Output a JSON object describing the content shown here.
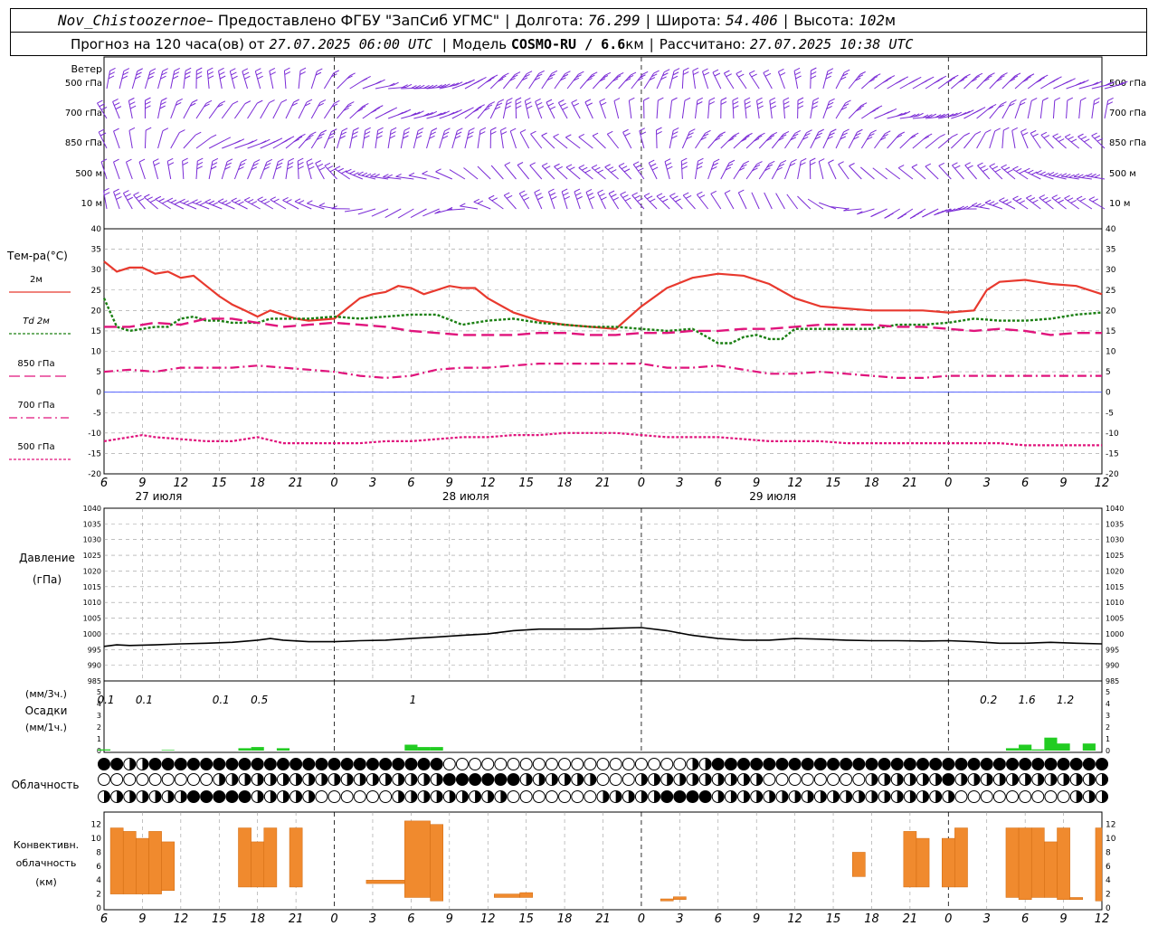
{
  "header": {
    "station": "Nov_Chistoozernoe",
    "provider": " – Предоставлено ФГБУ \"ЗапСиб УГМС\"",
    "lon_label": "Долгота:",
    "lon": "76.299",
    "lat_label": "Широта:",
    "lat": "54.406",
    "alt_label": "Высота:",
    "alt": "102",
    "alt_unit": "м",
    "forecast_label": "Прогноз на 120 часа(ов) от",
    "forecast_start": "27.07.2025 06:00 UTC",
    "model_label": "Модель",
    "model": "COSMO-RU / 6.6",
    "model_unit": "км",
    "calc_label": "Рассчитано:",
    "calc_time": "27.07.2025 10:38 UTC"
  },
  "wind_panel": {
    "title": "Ветер",
    "levels": [
      "500 гПа",
      "700 гПа",
      "850 гПа",
      "500  м",
      "10   м"
    ]
  },
  "temp_panel": {
    "title": "Тем-ра(°С)",
    "legend": [
      {
        "label": "2м",
        "color": "#e8392e",
        "style": "solid"
      },
      {
        "label": "Td  2м",
        "color": "#1a7f12",
        "style": "dotted"
      },
      {
        "label": "850 гПа",
        "color": "#e0147c",
        "style": "dashed"
      },
      {
        "label": "700 гПа",
        "color": "#e0147c",
        "style": "dashdot"
      },
      {
        "label": "500 гПа",
        "color": "#e0147c",
        "style": "dotted"
      }
    ]
  },
  "pressure_panel": {
    "title_line1": "Давление",
    "title_line2": "(гПа)"
  },
  "precip_panel": {
    "unit3": "(мм/3ч.)",
    "title": "Осадки",
    "unit1": "(мм/1ч.)",
    "labels": [
      {
        "x": 6,
        "text": "0.1"
      },
      {
        "x": 9,
        "text": "0.1"
      },
      {
        "x": 15,
        "text": "0.1"
      },
      {
        "x": 18,
        "text": "0.5"
      },
      {
        "x": 30,
        "text": "1"
      },
      {
        "x": 75,
        "text": "0.2"
      },
      {
        "x": 78,
        "text": "1.6"
      },
      {
        "x": 81,
        "text": "1.2"
      }
    ]
  },
  "cloud_panel": {
    "title": "Облачность"
  },
  "conv_panel": {
    "title_line1": "Конвективн.",
    "title_line2": "облачность",
    "title_line3": "(км)"
  },
  "chart_data": [
    {
      "type": "wind_barbs",
      "x_hours_range": [
        6,
        84
      ],
      "levels": [
        "500 гПа",
        "700 гПа",
        "850 гПа",
        "500  м",
        "10   м"
      ]
    },
    {
      "type": "line",
      "x_hours_range": [
        6,
        84
      ],
      "ylim": [
        -20,
        40
      ],
      "yticks": [
        -20,
        -15,
        -10,
        -5,
        0,
        5,
        10,
        15,
        20,
        25,
        30,
        35,
        40
      ],
      "grid": true,
      "series": [
        {
          "name": "2м",
          "x": [
            6,
            7,
            8,
            9,
            10,
            11,
            12,
            13,
            14,
            15,
            16,
            17,
            18,
            19,
            20,
            21,
            22,
            24,
            26,
            27,
            28,
            29,
            30,
            31,
            32,
            33,
            34,
            35,
            36,
            38,
            40,
            42,
            44,
            46,
            48,
            50,
            52,
            54,
            56,
            58,
            60,
            62,
            64,
            66,
            68,
            70,
            72,
            74,
            75,
            76,
            78,
            80,
            82,
            84
          ],
          "values": [
            32,
            29.5,
            30.5,
            30.5,
            29,
            29.5,
            28,
            28.5,
            26,
            23.5,
            21.5,
            20,
            18.5,
            20,
            19,
            18,
            17.5,
            18,
            23,
            24,
            24.5,
            26,
            25.5,
            24,
            25,
            26,
            25.5,
            25.5,
            23,
            19.5,
            17.5,
            16.5,
            16,
            15.5,
            21,
            25.5,
            28,
            29,
            28.5,
            26.5,
            23,
            21,
            20.5,
            20,
            20,
            20,
            19.5,
            20,
            25,
            27,
            27.5,
            26.5,
            26,
            24
          ]
        },
        {
          "name": "Td  2м",
          "x": [
            6,
            7,
            8,
            9,
            10,
            11,
            12,
            13,
            14,
            15,
            16,
            17,
            18,
            19,
            20,
            21,
            22,
            24,
            26,
            28,
            30,
            32,
            34,
            36,
            38,
            40,
            42,
            44,
            46,
            48,
            50,
            52,
            54,
            55,
            56,
            57,
            58,
            59,
            60,
            62,
            64,
            66,
            68,
            70,
            72,
            74,
            76,
            78,
            80,
            82,
            84
          ],
          "values": [
            23,
            16,
            15,
            15.5,
            16,
            16,
            18,
            18.5,
            17.5,
            17.5,
            17,
            17,
            17,
            18,
            18,
            18,
            18,
            18.5,
            18,
            18.5,
            19,
            19,
            16.5,
            17.5,
            18,
            17,
            16.5,
            16,
            16,
            15.5,
            15,
            15.5,
            12,
            12,
            13.5,
            14,
            13,
            13,
            15.5,
            15.5,
            15.5,
            15.5,
            16.5,
            16.5,
            17,
            18,
            17.5,
            17.5,
            18,
            19,
            19.5
          ]
        },
        {
          "name": "850 гПа",
          "x": [
            6,
            8,
            10,
            12,
            14,
            16,
            18,
            20,
            22,
            24,
            26,
            28,
            30,
            32,
            34,
            36,
            38,
            40,
            42,
            44,
            46,
            48,
            50,
            52,
            54,
            56,
            58,
            60,
            62,
            64,
            66,
            68,
            70,
            72,
            74,
            76,
            78,
            80,
            82,
            84
          ],
          "values": [
            16,
            16,
            17,
            16.5,
            18,
            18,
            17,
            16,
            16.5,
            17,
            16.5,
            16,
            15,
            14.5,
            14,
            14,
            14,
            14.5,
            14.5,
            14,
            14,
            14.5,
            14.5,
            15,
            15,
            15.5,
            15.5,
            16,
            16.5,
            16.5,
            16.5,
            16,
            16,
            15.5,
            15,
            15.5,
            15,
            14,
            14.5,
            14.5
          ]
        },
        {
          "name": "700 гПа",
          "x": [
            6,
            8,
            10,
            12,
            14,
            16,
            18,
            20,
            22,
            24,
            26,
            28,
            30,
            32,
            34,
            36,
            38,
            40,
            42,
            44,
            46,
            48,
            50,
            52,
            54,
            56,
            58,
            60,
            62,
            64,
            66,
            68,
            70,
            72,
            74,
            76,
            78,
            80,
            82,
            84
          ],
          "values": [
            5,
            5.5,
            5,
            6,
            6,
            6,
            6.5,
            6,
            5.5,
            5,
            4,
            3.5,
            4,
            5.5,
            6,
            6,
            6.5,
            7,
            7,
            7,
            7,
            7,
            6,
            6,
            6.5,
            5.5,
            4.5,
            4.5,
            5,
            4.5,
            4,
            3.5,
            3.5,
            4,
            4,
            4,
            4,
            4,
            4,
            4
          ]
        },
        {
          "name": "500 гПа",
          "x": [
            6,
            8,
            9,
            10,
            12,
            14,
            16,
            18,
            20,
            22,
            24,
            26,
            28,
            30,
            32,
            34,
            36,
            38,
            40,
            42,
            44,
            46,
            48,
            50,
            52,
            54,
            56,
            58,
            60,
            62,
            64,
            66,
            68,
            70,
            72,
            74,
            76,
            78,
            80,
            82,
            84
          ],
          "values": [
            -12,
            -11,
            -10.5,
            -11,
            -11.5,
            -12,
            -12,
            -11,
            -12.5,
            -12.5,
            -12.5,
            -12.5,
            -12,
            -12,
            -11.5,
            -11,
            -11,
            -10.5,
            -10.5,
            -10,
            -10,
            -10,
            -10.5,
            -11,
            -11,
            -11,
            -11.5,
            -12,
            -12,
            -12,
            -12.5,
            -12.5,
            -12.5,
            -12.5,
            -12.5,
            -12.5,
            -12.5,
            -13,
            -13,
            -13,
            -13
          ]
        }
      ]
    },
    {
      "type": "line",
      "x_hours_range": [
        6,
        84
      ],
      "ylim": [
        985,
        1040
      ],
      "yticks": [
        985,
        990,
        995,
        1000,
        1005,
        1010,
        1015,
        1020,
        1025,
        1030,
        1035,
        1040
      ],
      "grid": true,
      "series": [
        {
          "name": "",
          "x": [
            6,
            7,
            8,
            10,
            12,
            14,
            16,
            18,
            19,
            20,
            22,
            24,
            26,
            28,
            30,
            32,
            34,
            36,
            38,
            40,
            42,
            44,
            46,
            48,
            50,
            52,
            54,
            56,
            58,
            60,
            62,
            64,
            66,
            68,
            70,
            72,
            74,
            76,
            78,
            80,
            82,
            84
          ],
          "values": [
            996,
            996.5,
            996.3,
            996.5,
            996.8,
            997,
            997.3,
            998,
            998.5,
            998,
            997.5,
            997.5,
            997.8,
            998,
            998.5,
            999,
            999.5,
            1000,
            1001,
            1001.5,
            1001.5,
            1001.5,
            1001.8,
            1002,
            1001,
            999.5,
            998.5,
            998,
            998,
            998.5,
            998.3,
            998,
            997.8,
            997.8,
            997.7,
            997.8,
            997.5,
            997,
            997,
            997.3,
            997,
            996.8
          ]
        }
      ]
    },
    {
      "type": "bar",
      "x_hours_range": [
        6,
        84
      ],
      "ylim": [
        0,
        5
      ],
      "yticks": [
        0,
        1,
        2,
        3,
        4,
        5
      ],
      "bars_x": [
        6,
        11,
        17,
        18,
        20,
        30,
        31,
        32,
        77,
        78,
        79,
        80,
        81,
        83
      ],
      "bars_mm_per_h": [
        0.1,
        0.05,
        0.2,
        0.3,
        0.2,
        0.5,
        0.3,
        0.3,
        0.2,
        0.5,
        0.1,
        1.1,
        0.6,
        0.6
      ]
    },
    {
      "type": "table",
      "name": "cloud_cover_symbols",
      "layers": 3,
      "x_hours_range": [
        6,
        84
      ]
    },
    {
      "type": "bar",
      "x_hours_range": [
        6,
        84
      ],
      "ylim": [
        0,
        13
      ],
      "yticks": [
        0,
        2,
        4,
        6,
        8,
        10,
        12
      ],
      "bars": [
        {
          "x0": 6.5,
          "x1": 7.5,
          "bottom": 2,
          "top": 11.5
        },
        {
          "x0": 7.5,
          "x1": 8.5,
          "bottom": 2,
          "top": 11
        },
        {
          "x0": 8.5,
          "x1": 9.5,
          "bottom": 2,
          "top": 10
        },
        {
          "x0": 9.5,
          "x1": 10.5,
          "bottom": 2,
          "top": 11
        },
        {
          "x0": 10.5,
          "x1": 11.5,
          "bottom": 2.5,
          "top": 9.5
        },
        {
          "x0": 16.5,
          "x1": 17.5,
          "bottom": 3,
          "top": 11.5
        },
        {
          "x0": 17.5,
          "x1": 18.5,
          "bottom": 3,
          "top": 9.5
        },
        {
          "x0": 18.5,
          "x1": 19.5,
          "bottom": 3,
          "top": 11.5
        },
        {
          "x0": 20.5,
          "x1": 21.5,
          "bottom": 3,
          "top": 11.5
        },
        {
          "x0": 26.5,
          "x1": 29.5,
          "bottom": 3.5,
          "top": 4
        },
        {
          "x0": 29.5,
          "x1": 31.5,
          "bottom": 1.5,
          "top": 12.5
        },
        {
          "x0": 31.5,
          "x1": 32.5,
          "bottom": 1,
          "top": 12
        },
        {
          "x0": 36.5,
          "x1": 38.5,
          "bottom": 1.5,
          "top": 2
        },
        {
          "x0": 38.5,
          "x1": 39.5,
          "bottom": 1.5,
          "top": 2.2
        },
        {
          "x0": 49.5,
          "x1": 50.5,
          "bottom": 1,
          "top": 1.3
        },
        {
          "x0": 50.5,
          "x1": 51.5,
          "bottom": 1.2,
          "top": 1.6
        },
        {
          "x0": 64.5,
          "x1": 65.5,
          "bottom": 4.5,
          "top": 8
        },
        {
          "x0": 68.5,
          "x1": 69.5,
          "bottom": 3,
          "top": 11
        },
        {
          "x0": 69.5,
          "x1": 70.5,
          "bottom": 3,
          "top": 10
        },
        {
          "x0": 71.5,
          "x1": 72.5,
          "bottom": 3,
          "top": 10
        },
        {
          "x0": 72.5,
          "x1": 73.5,
          "bottom": 3,
          "top": 11.5
        },
        {
          "x0": 76.5,
          "x1": 77.5,
          "bottom": 1.5,
          "top": 11.5
        },
        {
          "x0": 77.5,
          "x1": 78.5,
          "bottom": 1.2,
          "top": 11.5
        },
        {
          "x0": 78.5,
          "x1": 79.5,
          "bottom": 1.5,
          "top": 11.5
        },
        {
          "x0": 79.5,
          "x1": 80.5,
          "bottom": 1.5,
          "top": 9.5
        },
        {
          "x0": 80.5,
          "x1": 81.5,
          "bottom": 1.2,
          "top": 11.5
        },
        {
          "x0": 81.5,
          "x1": 82.5,
          "bottom": 1.2,
          "top": 1.5
        },
        {
          "x0": 83.5,
          "x1": 84,
          "bottom": 1,
          "top": 11.5
        }
      ]
    }
  ],
  "time_axis": {
    "tick_hours": [
      6,
      9,
      12,
      15,
      18,
      21,
      24,
      27,
      30,
      33,
      36,
      39,
      42,
      45,
      48,
      51,
      54,
      57,
      60,
      63,
      66,
      69,
      72,
      75,
      78,
      81,
      84
    ],
    "tick_labels": [
      "6",
      "9",
      "12",
      "15",
      "18",
      "21",
      "0",
      "3",
      "6",
      "9",
      "12",
      "15",
      "18",
      "21",
      "0",
      "3",
      "6",
      "9",
      "12",
      "15",
      "18",
      "21",
      "0",
      "3",
      "6",
      "9",
      "12"
    ],
    "day_hours": [
      9,
      33,
      57
    ],
    "day_labels": [
      "27 июля",
      "28 июля",
      "29 июля"
    ],
    "midnight_hours": [
      24,
      48,
      72
    ]
  }
}
